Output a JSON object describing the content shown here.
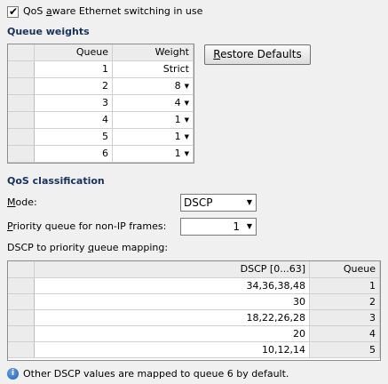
{
  "qos_aware": {
    "checked": true,
    "check_glyph": "✔",
    "label": "QoS aware Ethernet switching in use"
  },
  "queue_weights": {
    "title": "Queue weights",
    "headers": {
      "queue": "Queue",
      "weight": "Weight"
    },
    "rows": [
      {
        "queue": "1",
        "weight": "Strict",
        "dropdown": false
      },
      {
        "queue": "2",
        "weight": "8",
        "dropdown": true
      },
      {
        "queue": "3",
        "weight": "4",
        "dropdown": true
      },
      {
        "queue": "4",
        "weight": "1",
        "dropdown": true
      },
      {
        "queue": "5",
        "weight": "1",
        "dropdown": true
      },
      {
        "queue": "6",
        "weight": "1",
        "dropdown": true
      }
    ],
    "dropdown_glyph": "▼"
  },
  "restore_defaults": {
    "label": "Restore Defaults"
  },
  "qos_classification": {
    "title": "QoS classification",
    "mode_label": "Mode:",
    "mode_value": "DSCP",
    "priority_label": "Priority queue for non-IP frames:",
    "priority_value": "1",
    "combo_glyph": "▼",
    "mapping_label": "DSCP to priority queue mapping:"
  },
  "dscp_table": {
    "headers": {
      "dscp": "DSCP [0...63]",
      "queue": "Queue"
    },
    "rows": [
      {
        "dscp": "34,36,38,48",
        "queue": "1"
      },
      {
        "dscp": "30",
        "queue": "2"
      },
      {
        "dscp": "18,22,26,28",
        "queue": "3"
      },
      {
        "dscp": "20",
        "queue": "4"
      },
      {
        "dscp": "10,12,14",
        "queue": "5"
      }
    ]
  },
  "info": {
    "icon_glyph": "i",
    "text": "Other DSCP values are mapped to queue 6 by default."
  }
}
